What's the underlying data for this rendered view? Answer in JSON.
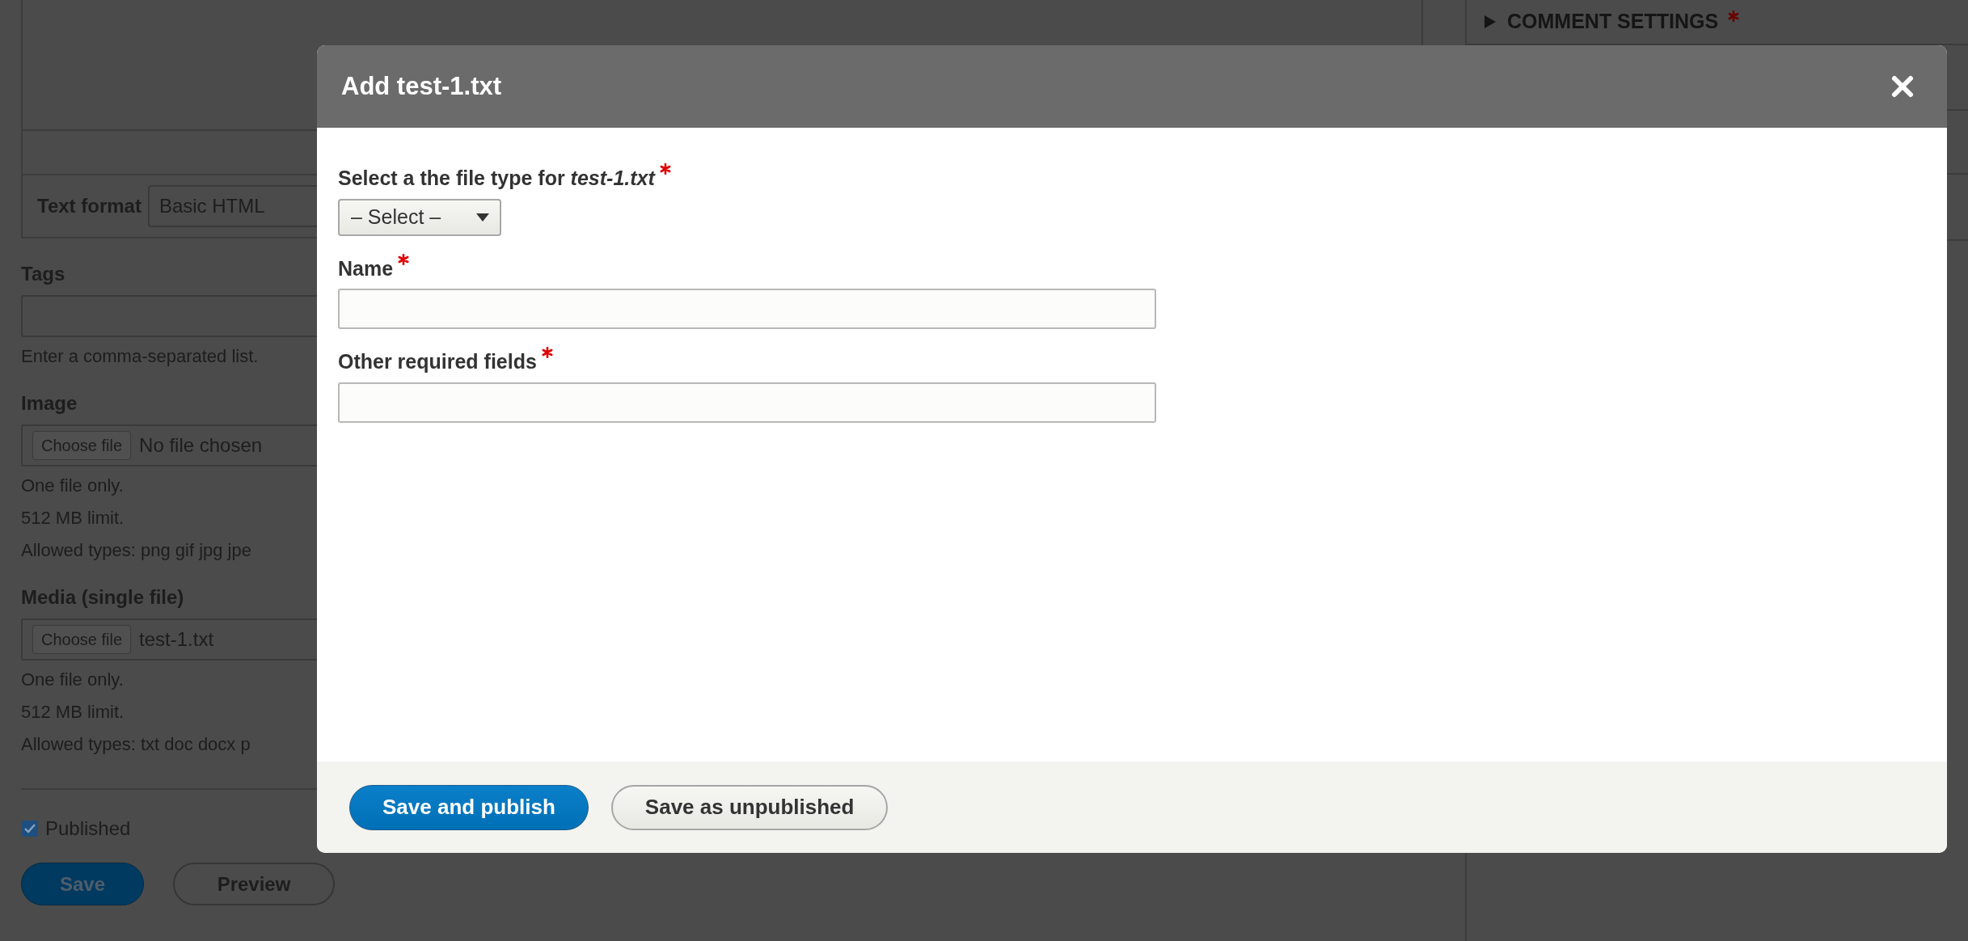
{
  "background_form": {
    "text_format": {
      "label": "Text format",
      "value": "Basic HTML"
    },
    "fields": [
      {
        "kind": "text",
        "label": "Tags",
        "help": [
          "Enter a comma-separated list."
        ]
      },
      {
        "kind": "file",
        "label": "Image",
        "button": "Choose file",
        "file": "No file chosen",
        "help": [
          "One file only.",
          "512 MB limit.",
          "Allowed types: png gif jpg jpe"
        ]
      },
      {
        "kind": "file",
        "label": "Media (single file)",
        "button": "Choose file",
        "file": "test-1.txt",
        "help": [
          "One file only.",
          "512 MB limit.",
          "Allowed types: txt doc docx p"
        ]
      }
    ],
    "published": {
      "label": "Published",
      "checked": true
    },
    "buttons": [
      {
        "label": "Save",
        "kind": "primary"
      },
      {
        "label": "Preview",
        "kind": "secondary"
      }
    ]
  },
  "sidebar": {
    "sections": [
      {
        "title": "COMMENT SETTINGS",
        "required": true,
        "expanded": false
      }
    ]
  },
  "dialog": {
    "title": "Add test-1.txt",
    "fields": [
      {
        "kind": "select",
        "label": "Select a the file type for *test-1.txt*",
        "required": true,
        "value": "– Select –"
      },
      {
        "kind": "text",
        "label": "Name",
        "required": true
      },
      {
        "kind": "text",
        "label": "Other required fields",
        "required": true
      }
    ],
    "buttons": [
      {
        "label": "Save and publish",
        "kind": "primary"
      },
      {
        "label": "Save as unpublished",
        "kind": "secondary"
      }
    ]
  }
}
